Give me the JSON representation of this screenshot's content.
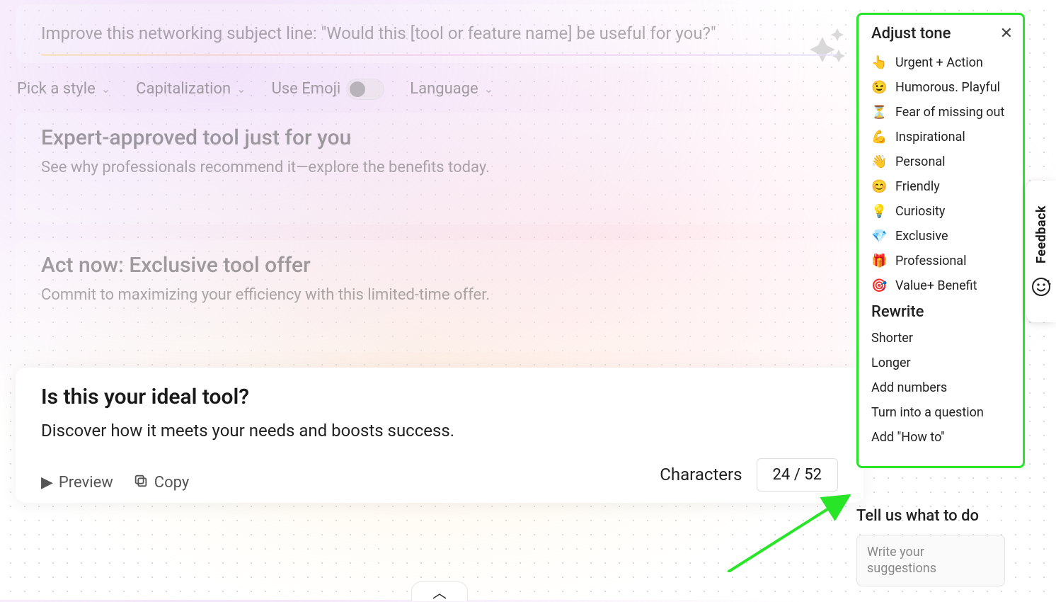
{
  "prompt": {
    "text": "Improve this networking subject line: \"Would this [tool or feature name] be useful for you?\""
  },
  "options": {
    "pick_style": "Pick a style",
    "capitalization": "Capitalization",
    "use_emoji": "Use Emoji",
    "language": "Language"
  },
  "results": [
    {
      "title": "Expert-approved tool just for you",
      "subtitle": "See why professionals recommend it—explore the benefits today."
    },
    {
      "title": "Act now: Exclusive tool offer",
      "subtitle": "Commit to maximizing your efficiency with this limited-time offer."
    }
  ],
  "focus_card": {
    "title": "Is this your ideal tool?",
    "subtitle": "Discover how it meets your needs and boosts success.",
    "preview_label": "Preview",
    "copy_label": "Copy",
    "characters_label": "Characters",
    "char_count": "24 / 52"
  },
  "panel": {
    "adjust_title": "Adjust tone",
    "tones": [
      {
        "emoji": "👆",
        "label": "Urgent + Action"
      },
      {
        "emoji": "😉",
        "label": "Humorous. Playful"
      },
      {
        "emoji": "⏳",
        "label": "Fear of missing out"
      },
      {
        "emoji": "💪",
        "label": "Inspirational"
      },
      {
        "emoji": "👋",
        "label": "Personal"
      },
      {
        "emoji": "😊",
        "label": "Friendly"
      },
      {
        "emoji": "💡",
        "label": "Curiosity"
      },
      {
        "emoji": "💎",
        "label": "Exclusive"
      },
      {
        "emoji": "🎁",
        "label": "Professional"
      },
      {
        "emoji": "🎯",
        "label": "Value+ Benefit"
      }
    ],
    "rewrite_title": "Rewrite",
    "rewrites": [
      "Shorter",
      "Longer",
      "Add numbers",
      "Turn into a question",
      "Add \"How to\""
    ]
  },
  "tell_us": {
    "title": "Tell us what to do",
    "placeholder": "Write your suggestions"
  },
  "feedback_label": "Feedback"
}
